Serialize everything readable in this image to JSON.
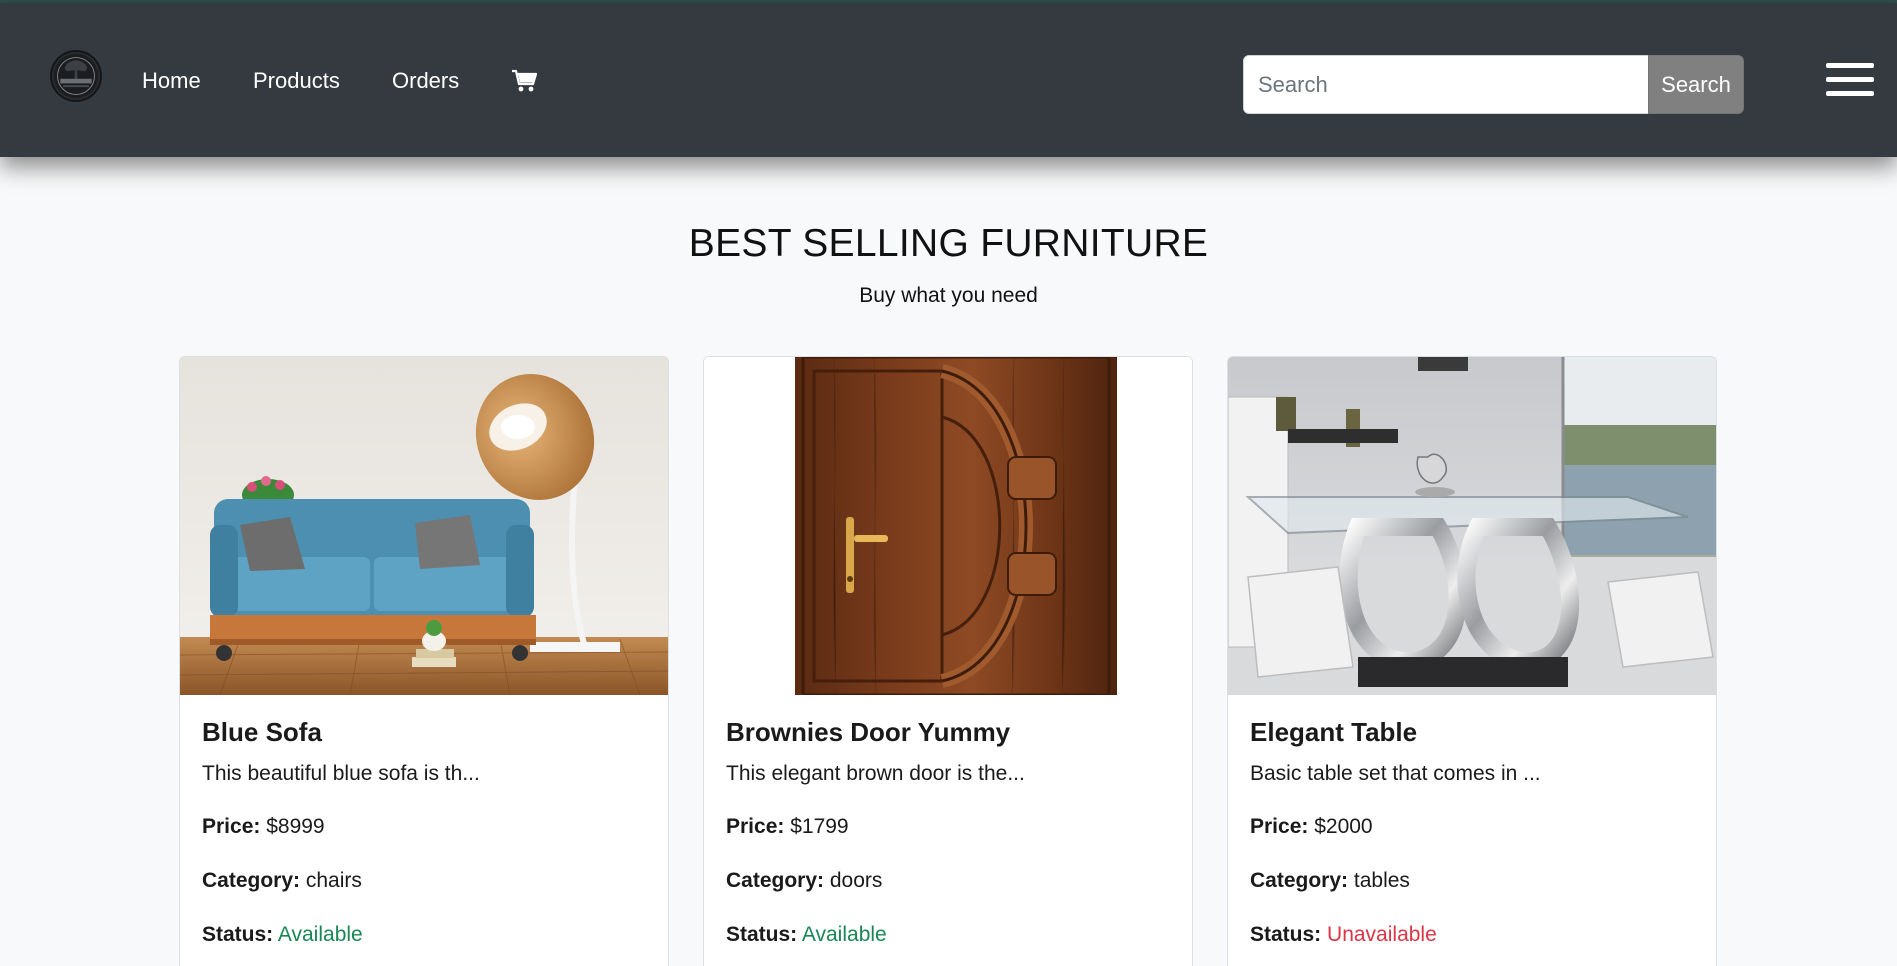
{
  "navbar": {
    "links": [
      "Home",
      "Products",
      "Orders"
    ],
    "cart_icon": "cart-icon",
    "search": {
      "placeholder": "Search",
      "value": "",
      "button_label": "Search"
    },
    "menu_icon": "hamburger-menu-icon"
  },
  "hero": {
    "title": "BEST SELLING FURNITURE",
    "subtitle": "Buy what you need"
  },
  "labels": {
    "price": "Price:",
    "category": "Category:",
    "status": "Status:"
  },
  "products": [
    {
      "name": "Blue Sofa",
      "description": "This beautiful blue sofa is th...",
      "price": "$8999",
      "category": "chairs",
      "status": "Available",
      "image": "blue-sofa-photo"
    },
    {
      "name": "Brownies Door Yummy",
      "description": "This elegant brown door is the...",
      "price": "$1799",
      "category": "doors",
      "status": "Available",
      "image": "brown-door-photo"
    },
    {
      "name": "Elegant Table",
      "description": "Basic table set that comes in ...",
      "price": "$2000",
      "category": "tables",
      "status": "Unavailable",
      "image": "glass-table-photo"
    }
  ],
  "colors": {
    "navbar": "#343a40",
    "available": "#198754",
    "unavailable": "#dc3545",
    "search_button": "#808080",
    "page_background": "#f8f9fa"
  }
}
